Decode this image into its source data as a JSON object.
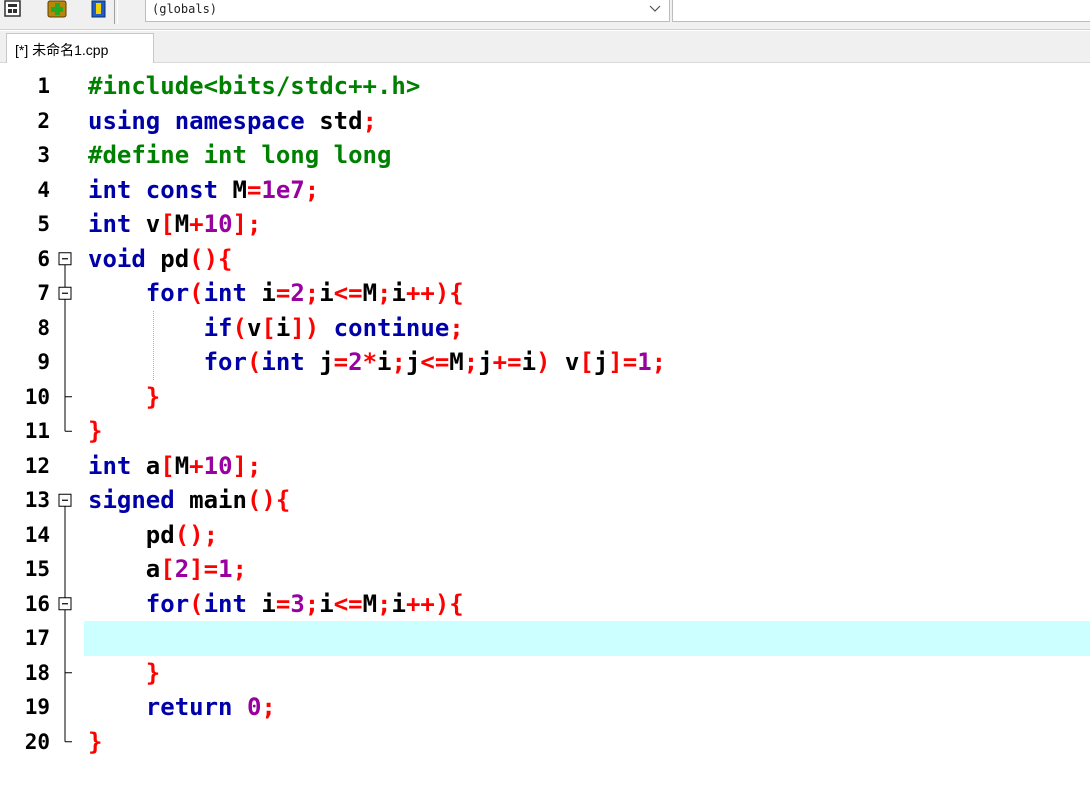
{
  "toolbar": {
    "buttons": [
      {
        "name": "insert-snippet-button",
        "icon": "code-insert-icon"
      },
      {
        "name": "add-to-project-button",
        "icon": "add-plus-icon"
      },
      {
        "name": "project-options-button",
        "icon": "project-icon"
      }
    ],
    "scope_value": "(globals)",
    "scope_arrow_icon": "chevron-down-icon"
  },
  "tabs": [
    {
      "label": "[*] 未命名1.cpp",
      "active": true
    }
  ],
  "editor": {
    "current_line": 17,
    "highlight_color": "#ccffff",
    "colors": {
      "keyword": "#0000a8",
      "symbol": "#ff0000",
      "number": "#9800a0",
      "preprocessor": "#008000",
      "identifier": "#000000"
    },
    "lines": [
      {
        "n": "1",
        "tokens": [
          {
            "t": "pre",
            "v": "#include<bits/stdc++.h>"
          }
        ]
      },
      {
        "n": "2",
        "tokens": [
          {
            "t": "kw",
            "v": "using namespace"
          },
          {
            "t": "idf",
            "v": " std"
          },
          {
            "t": "sym",
            "v": ";"
          }
        ]
      },
      {
        "n": "3",
        "tokens": [
          {
            "t": "pre",
            "v": "#define int long long"
          }
        ]
      },
      {
        "n": "4",
        "tokens": [
          {
            "t": "kw",
            "v": "int const"
          },
          {
            "t": "idf",
            "v": " M"
          },
          {
            "t": "sym",
            "v": "="
          },
          {
            "t": "num",
            "v": "1e7"
          },
          {
            "t": "sym",
            "v": ";"
          }
        ]
      },
      {
        "n": "5",
        "tokens": [
          {
            "t": "kw",
            "v": "int"
          },
          {
            "t": "idf",
            "v": " v"
          },
          {
            "t": "sym",
            "v": "["
          },
          {
            "t": "idf",
            "v": "M"
          },
          {
            "t": "sym",
            "v": "+"
          },
          {
            "t": "num",
            "v": "10"
          },
          {
            "t": "sym",
            "v": "];"
          }
        ]
      },
      {
        "n": "6",
        "tokens": [
          {
            "t": "kw",
            "v": "void"
          },
          {
            "t": "idf",
            "v": " pd"
          },
          {
            "t": "sym",
            "v": "(){"
          }
        ]
      },
      {
        "n": "7",
        "tokens": [
          {
            "t": "idf",
            "v": "    "
          },
          {
            "t": "kw",
            "v": "for"
          },
          {
            "t": "sym",
            "v": "("
          },
          {
            "t": "kw",
            "v": "int"
          },
          {
            "t": "idf",
            "v": " i"
          },
          {
            "t": "sym",
            "v": "="
          },
          {
            "t": "num",
            "v": "2"
          },
          {
            "t": "sym",
            "v": ";"
          },
          {
            "t": "idf",
            "v": "i"
          },
          {
            "t": "sym",
            "v": "<="
          },
          {
            "t": "idf",
            "v": "M"
          },
          {
            "t": "sym",
            "v": ";"
          },
          {
            "t": "idf",
            "v": "i"
          },
          {
            "t": "sym",
            "v": "++){"
          }
        ]
      },
      {
        "n": "8",
        "tokens": [
          {
            "t": "idf",
            "v": "        "
          },
          {
            "t": "kw",
            "v": "if"
          },
          {
            "t": "sym",
            "v": "("
          },
          {
            "t": "idf",
            "v": "v"
          },
          {
            "t": "sym",
            "v": "["
          },
          {
            "t": "idf",
            "v": "i"
          },
          {
            "t": "sym",
            "v": "])"
          },
          {
            "t": "kw",
            "v": " continue"
          },
          {
            "t": "sym",
            "v": ";"
          }
        ]
      },
      {
        "n": "9",
        "tokens": [
          {
            "t": "idf",
            "v": "        "
          },
          {
            "t": "kw",
            "v": "for"
          },
          {
            "t": "sym",
            "v": "("
          },
          {
            "t": "kw",
            "v": "int"
          },
          {
            "t": "idf",
            "v": " j"
          },
          {
            "t": "sym",
            "v": "="
          },
          {
            "t": "num",
            "v": "2"
          },
          {
            "t": "sym",
            "v": "*"
          },
          {
            "t": "idf",
            "v": "i"
          },
          {
            "t": "sym",
            "v": ";"
          },
          {
            "t": "idf",
            "v": "j"
          },
          {
            "t": "sym",
            "v": "<="
          },
          {
            "t": "idf",
            "v": "M"
          },
          {
            "t": "sym",
            "v": ";"
          },
          {
            "t": "idf",
            "v": "j"
          },
          {
            "t": "sym",
            "v": "+="
          },
          {
            "t": "idf",
            "v": "i"
          },
          {
            "t": "sym",
            "v": ")"
          },
          {
            "t": "idf",
            "v": " v"
          },
          {
            "t": "sym",
            "v": "["
          },
          {
            "t": "idf",
            "v": "j"
          },
          {
            "t": "sym",
            "v": "]="
          },
          {
            "t": "num",
            "v": "1"
          },
          {
            "t": "sym",
            "v": ";"
          }
        ]
      },
      {
        "n": "10",
        "tokens": [
          {
            "t": "idf",
            "v": "    "
          },
          {
            "t": "sym",
            "v": "}"
          }
        ]
      },
      {
        "n": "11",
        "tokens": [
          {
            "t": "sym",
            "v": "}"
          }
        ]
      },
      {
        "n": "12",
        "tokens": [
          {
            "t": "kw",
            "v": "int"
          },
          {
            "t": "idf",
            "v": " a"
          },
          {
            "t": "sym",
            "v": "["
          },
          {
            "t": "idf",
            "v": "M"
          },
          {
            "t": "sym",
            "v": "+"
          },
          {
            "t": "num",
            "v": "10"
          },
          {
            "t": "sym",
            "v": "];"
          }
        ]
      },
      {
        "n": "13",
        "tokens": [
          {
            "t": "kw",
            "v": "signed"
          },
          {
            "t": "idf",
            "v": " main"
          },
          {
            "t": "sym",
            "v": "(){"
          }
        ]
      },
      {
        "n": "14",
        "tokens": [
          {
            "t": "idf",
            "v": "    pd"
          },
          {
            "t": "sym",
            "v": "();"
          }
        ]
      },
      {
        "n": "15",
        "tokens": [
          {
            "t": "idf",
            "v": "    a"
          },
          {
            "t": "sym",
            "v": "["
          },
          {
            "t": "num",
            "v": "2"
          },
          {
            "t": "sym",
            "v": "]="
          },
          {
            "t": "num",
            "v": "1"
          },
          {
            "t": "sym",
            "v": ";"
          }
        ]
      },
      {
        "n": "16",
        "tokens": [
          {
            "t": "idf",
            "v": "    "
          },
          {
            "t": "kw",
            "v": "for"
          },
          {
            "t": "sym",
            "v": "("
          },
          {
            "t": "kw",
            "v": "int"
          },
          {
            "t": "idf",
            "v": " i"
          },
          {
            "t": "sym",
            "v": "="
          },
          {
            "t": "num",
            "v": "3"
          },
          {
            "t": "sym",
            "v": ";"
          },
          {
            "t": "idf",
            "v": "i"
          },
          {
            "t": "sym",
            "v": "<="
          },
          {
            "t": "idf",
            "v": "M"
          },
          {
            "t": "sym",
            "v": ";"
          },
          {
            "t": "idf",
            "v": "i"
          },
          {
            "t": "sym",
            "v": "++){"
          }
        ]
      },
      {
        "n": "17",
        "tokens": []
      },
      {
        "n": "18",
        "tokens": [
          {
            "t": "idf",
            "v": "    "
          },
          {
            "t": "sym",
            "v": "}"
          }
        ]
      },
      {
        "n": "19",
        "tokens": [
          {
            "t": "idf",
            "v": "    "
          },
          {
            "t": "kw",
            "v": "return"
          },
          {
            "t": "num",
            "v": " 0"
          },
          {
            "t": "sym",
            "v": ";"
          }
        ]
      },
      {
        "n": "20",
        "tokens": [
          {
            "t": "sym",
            "v": "}"
          }
        ]
      }
    ]
  }
}
